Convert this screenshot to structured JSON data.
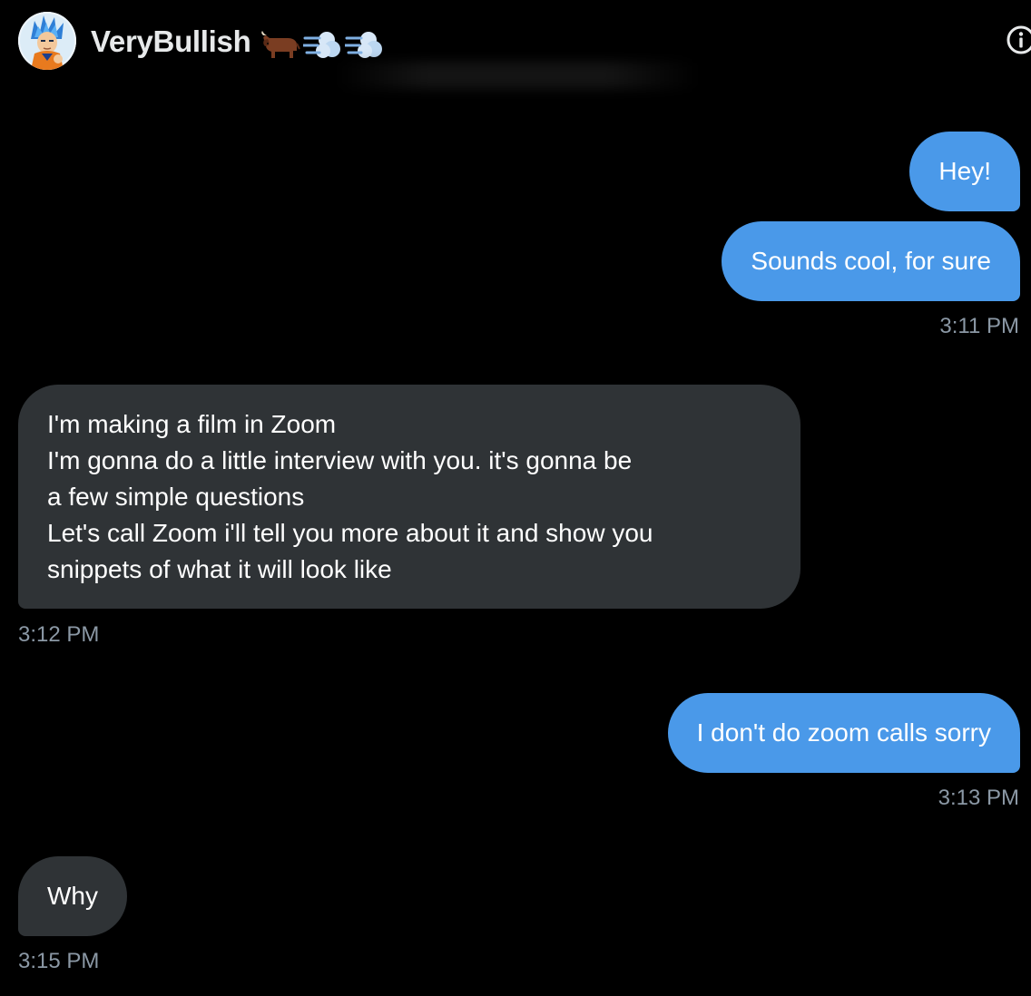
{
  "conversation": {
    "display_name": "VeryBullish",
    "name_emoji": [
      "ox-emoji",
      "dashing-away-emoji",
      "dashing-away-emoji"
    ],
    "avatar_icon": "anime-character-avatar",
    "info_icon": "info-icon"
  },
  "messages": [
    {
      "direction": "sent",
      "text": "Hey!"
    },
    {
      "direction": "sent",
      "text": "Sounds cool, for sure",
      "timestamp": "3:11 PM"
    },
    {
      "direction": "received",
      "text": "I'm making a film in Zoom\nI'm gonna do a little interview with you. it's gonna be\na few simple questions\nLet's call Zoom i'll tell you more about it and show you\nsnippets of what it will look like",
      "timestamp": "3:12 PM"
    },
    {
      "direction": "sent",
      "text": "I don't do zoom calls sorry",
      "timestamp": "3:13 PM"
    },
    {
      "direction": "received",
      "text": "Why",
      "timestamp": "3:15 PM"
    }
  ],
  "colors": {
    "background": "#000000",
    "sent_bubble": "#4a99e9",
    "received_bubble": "#2f3336",
    "timestamp": "#8b98a5"
  }
}
